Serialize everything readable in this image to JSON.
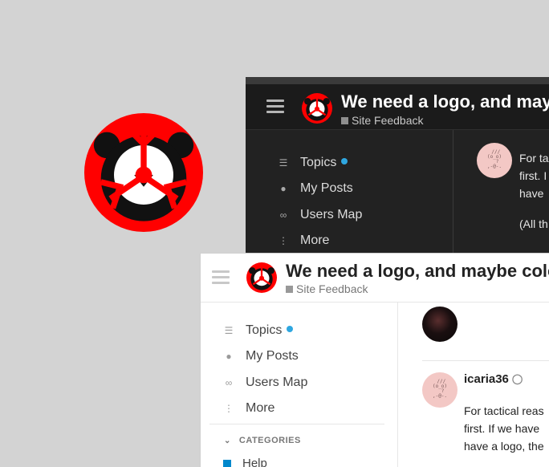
{
  "brand": {
    "logo_name": "site-logo",
    "accent": "#ff0000",
    "logo_dark": "#111111"
  },
  "dark_window": {
    "topic_title": "We need a logo, and may",
    "category": "Site Feedback",
    "nav": [
      {
        "label": "Topics",
        "icon": "layers-icon",
        "unread": true
      },
      {
        "label": "My Posts",
        "icon": "user-icon",
        "unread": false
      },
      {
        "label": "Users Map",
        "icon": "link-icon",
        "unread": false
      },
      {
        "label": "More",
        "icon": "vertical-ellipsis-icon",
        "unread": false
      }
    ],
    "post_lines": [
      "For ta",
      "first. I",
      "have"
    ],
    "post_extra": "(All th"
  },
  "light_window": {
    "topic_title": "We need a logo, and maybe colo",
    "category": "Site Feedback",
    "nav": [
      {
        "label": "Topics",
        "icon": "layers-icon",
        "unread": true
      },
      {
        "label": "My Posts",
        "icon": "user-icon",
        "unread": false
      },
      {
        "label": "Users Map",
        "icon": "link-icon",
        "unread": false
      },
      {
        "label": "More",
        "icon": "vertical-ellipsis-icon",
        "unread": false
      }
    ],
    "categories_heading": "CATEGORIES",
    "category_item": "Help",
    "post": {
      "username": "icaria36",
      "lines": [
        "For tactical reas",
        "first. If we have",
        "have a logo, the"
      ]
    }
  },
  "colors": {
    "unread_dot": "#2fa7e0",
    "category_help": "#0088cc",
    "avatar_pink": "#f3c8c5"
  }
}
